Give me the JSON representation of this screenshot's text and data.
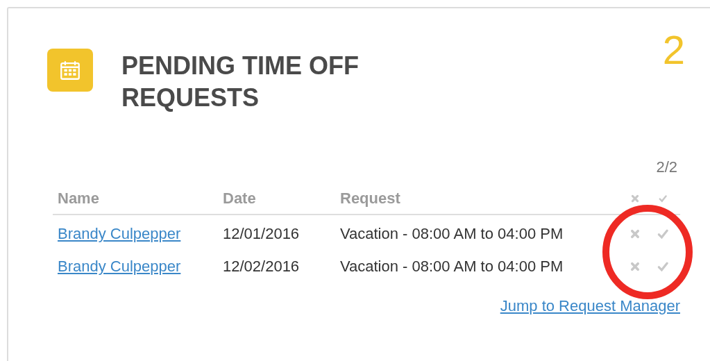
{
  "card": {
    "title": "PENDING TIME OFF REQUESTS",
    "count": "2"
  },
  "table": {
    "pager": "2/2",
    "columns": [
      {
        "kind": "text",
        "label": "Name"
      },
      {
        "kind": "text",
        "label": "Date"
      },
      {
        "kind": "text",
        "label": "Request"
      },
      {
        "kind": "deny"
      },
      {
        "kind": "approve"
      }
    ],
    "rows": [
      {
        "name": "Brandy Culpepper",
        "date": "12/01/2016",
        "request": "Vacation - 08:00 AM to 04:00 PM"
      },
      {
        "name": "Brandy Culpepper",
        "date": "12/02/2016",
        "request": "Vacation - 08:00 AM to 04:00 PM"
      }
    ]
  },
  "footer_link": "Jump to Request Manager"
}
